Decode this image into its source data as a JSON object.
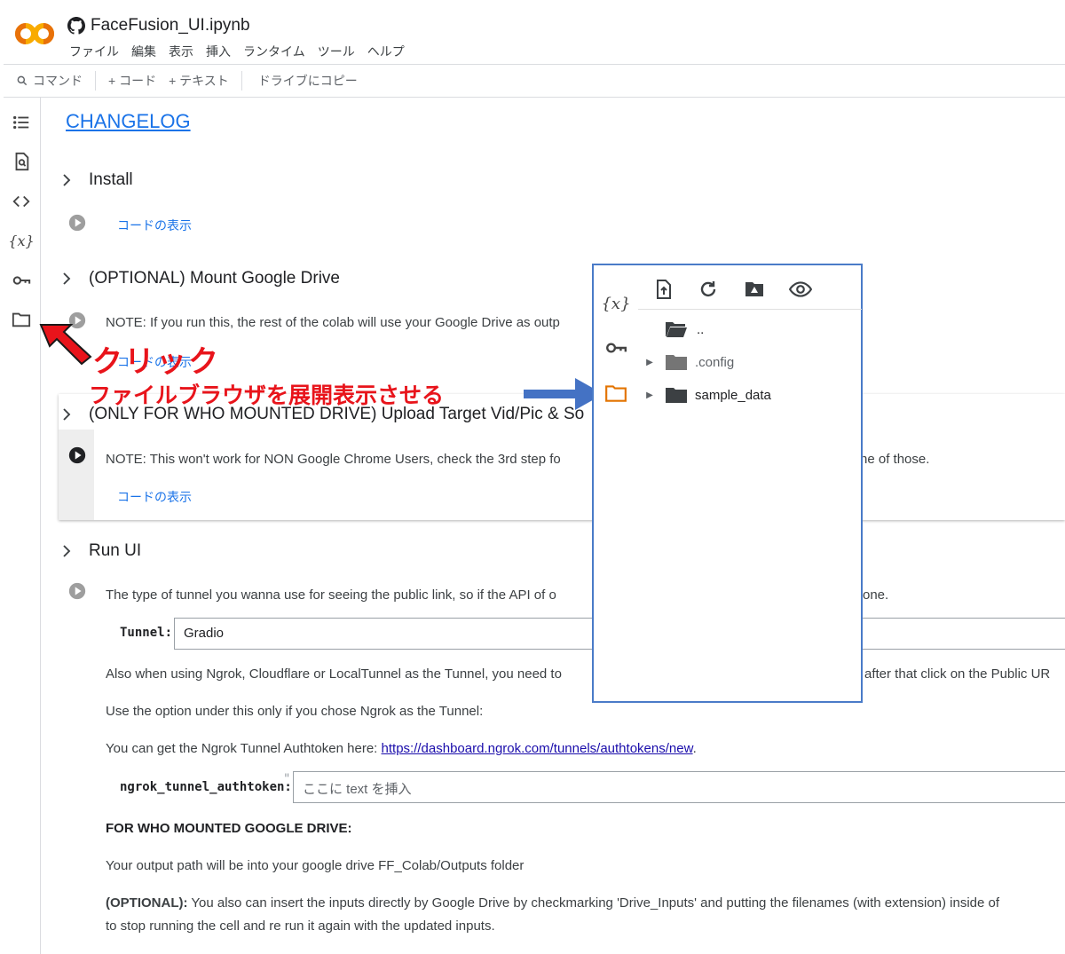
{
  "header": {
    "title": "FaceFusion_UI.ipynb",
    "menu": [
      "ファイル",
      "編集",
      "表示",
      "挿入",
      "ランタイム",
      "ツール",
      "ヘルプ"
    ]
  },
  "toolbar": {
    "command": "コマンド",
    "code": "+ コード",
    "text": "+ テキスト",
    "copy_drive": "ドライブにコピー"
  },
  "notebook": {
    "changelog": "CHANGELOG",
    "sections": {
      "install": "Install",
      "mount": "(OPTIONAL) Mount Google Drive",
      "upload": "(ONLY FOR WHO MOUNTED DRIVE) Upload Target Vid/Pic & So",
      "runui": "Run UI"
    },
    "show_code": "コードの表示",
    "mount_note": "NOTE: If you run this, the rest of the colab will use your Google Drive as outp",
    "upload_note_a": "NOTE: This won't work for NON Google Chrome Users, check the 3rd step fo",
    "upload_note_b": "ne of those.",
    "tunnel_desc_a": "The type of tunnel you wanna use for seeing the public link, so if the API of o",
    "tunnel_desc_b": "one.",
    "tunnel_label": "Tunnel:",
    "tunnel_value": "Gradio",
    "also_a": "Also when using Ngrok, Cloudflare or LocalTunnel as the Tunnel, you need to",
    "also_b": "after that click on the Public UR",
    "use_option": "Use the option under this only if you chose Ngrok as the Tunnel:",
    "authtoken_intro": "You can get the Ngrok Tunnel Authtoken here: ",
    "authtoken_link": "https://dashboard.ngrok.com/tunnels/authtokens/new",
    "authtoken_dot": ".",
    "authtoken_label": "ngrok_tunnel_authtoken:",
    "authtoken_quote": "\"",
    "authtoken_placeholder": "ここに text を挿入",
    "for_who": "FOR WHO MOUNTED GOOGLE DRIVE:",
    "output_path": "Your output path will be into your google drive FF_Colab/Outputs folder",
    "optional_bold": "(OPTIONAL):",
    "optional_text": " You also can insert the inputs directly by Google Drive by checkmarking 'Drive_Inputs' and putting the filenames (with extension) inside of",
    "optional_text2": "to stop running the cell and re run it again with the updated inputs."
  },
  "annotation": {
    "click": "クリック",
    "expand": "ファイルブラウザを展開表示させる",
    "red_color": "#e8141b",
    "blue_color": "#4472c4"
  },
  "file_browser": {
    "parent": "..",
    "items": [
      ".config",
      "sample_data"
    ]
  },
  "colors": {
    "accent": "#1a73e8",
    "folder_orange": "#e37400",
    "panel_border": "#4a7bc8"
  }
}
